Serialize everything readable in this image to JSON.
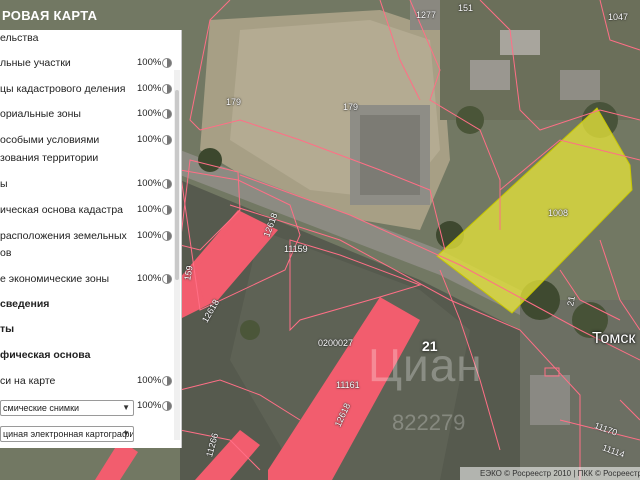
{
  "header": {
    "title": "РОВАЯ КАРТА"
  },
  "panel": {
    "rows": [
      {
        "label": "ельства",
        "pct": "",
        "bold": false
      },
      {
        "label": "льные участки",
        "pct": "100%",
        "bold": false
      },
      {
        "label": "цы кадастрового деления",
        "pct": "100%",
        "bold": false
      },
      {
        "label": "ориальные зоны",
        "pct": "100%",
        "bold": false
      },
      {
        "label": "особыми условиями",
        "pct": "100%",
        "bold": false
      },
      {
        "label": "зования территории",
        "pct": "",
        "bold": false
      },
      {
        "label": "ы",
        "pct": "100%",
        "bold": false
      },
      {
        "label": "ическая основа кадастра",
        "pct": "100%",
        "bold": false
      },
      {
        "label": "расположения земельных",
        "pct": "100%",
        "bold": false
      },
      {
        "label": "ов",
        "pct": "",
        "bold": false
      },
      {
        "label": "е экономические зоны",
        "pct": "100%",
        "bold": false
      },
      {
        "label": "сведения",
        "pct": "",
        "bold": true
      },
      {
        "label": "ты",
        "pct": "",
        "bold": true
      },
      {
        "label": "фическая основа",
        "pct": "",
        "bold": true
      },
      {
        "label": "си на карте",
        "pct": "100%",
        "bold": false
      }
    ],
    "select_imagery": {
      "value": "смические снимки",
      "pct": "100%"
    },
    "select_map": {
      "value": "циная электронная картографи"
    }
  },
  "map": {
    "labels": [
      "1277",
      "151",
      "1047",
      "179",
      "179",
      "1008",
      "11159",
      "12618",
      "12618",
      "159",
      "0200027",
      "21",
      "11161",
      "12618",
      "Томск",
      "11266",
      "11170",
      "11114",
      "21"
    ],
    "watermark": "Циан",
    "watermark_sub": "822279"
  },
  "footer": {
    "text": "ЕЭКО © Росреестр 2010 | ПКК © Росреестр"
  },
  "colors": {
    "highlight_parcel": "#e3e23a",
    "building_roof": "#f25d6e",
    "boundary": "#ff6f86"
  }
}
